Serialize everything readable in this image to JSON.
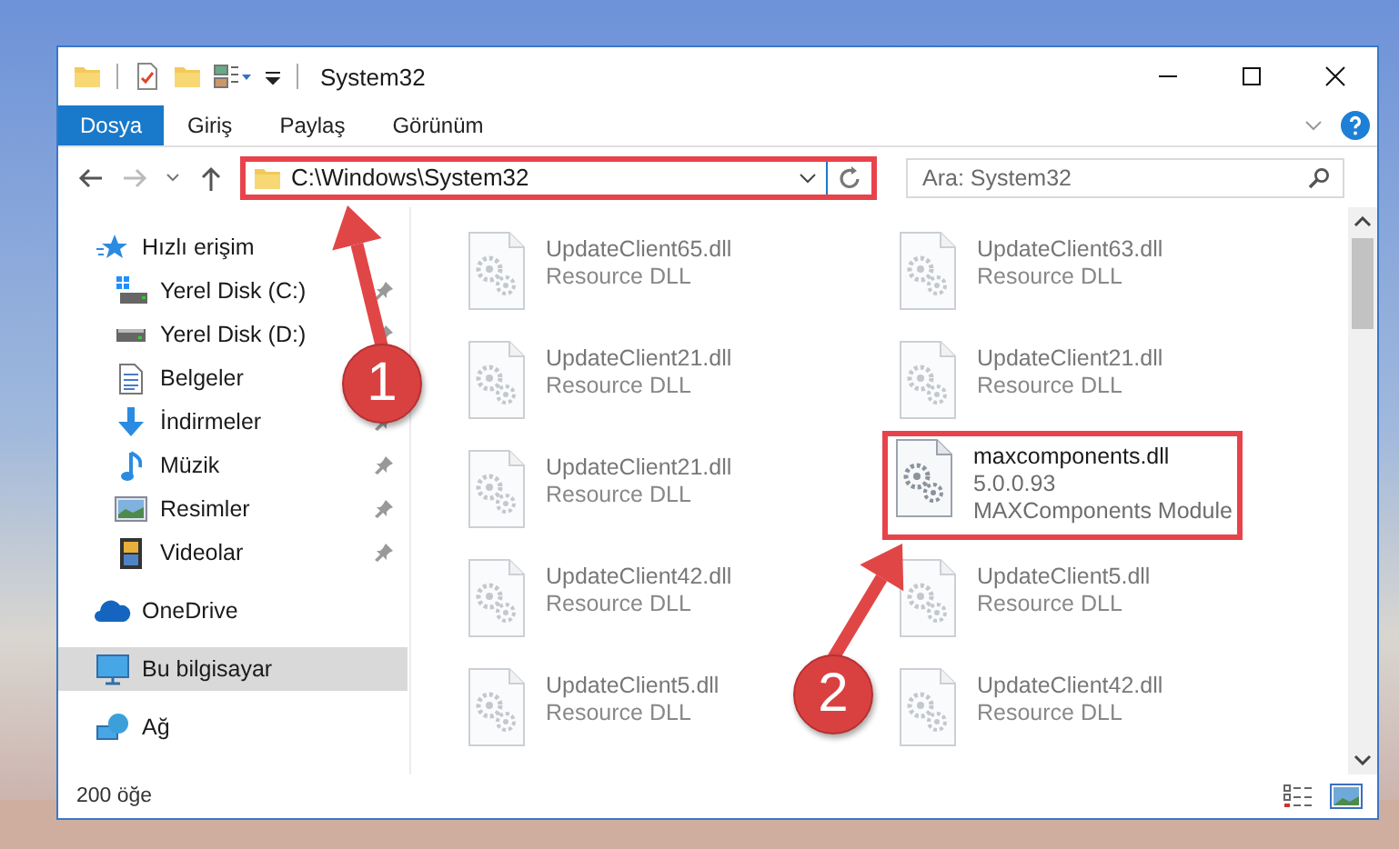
{
  "window": {
    "title": "System32"
  },
  "ribbon_tabs": [
    {
      "label": "Dosya",
      "selected": true
    },
    {
      "label": "Giriş",
      "selected": false
    },
    {
      "label": "Paylaş",
      "selected": false
    },
    {
      "label": "Görünüm",
      "selected": false
    }
  ],
  "address_bar": {
    "path": "C:\\Windows\\System32",
    "highlighted": true
  },
  "search": {
    "placeholder": "Ara: System32"
  },
  "navigation": [
    {
      "label": "Hızlı erişim",
      "kind": "star",
      "selected": false,
      "children": [
        {
          "label": "Yerel Disk (C:)",
          "kind": "system-drive",
          "pinned": true
        },
        {
          "label": "Yerel Disk (D:)",
          "kind": "drive",
          "pinned": true
        },
        {
          "label": "Belgeler",
          "kind": "document"
        },
        {
          "label": "İndirmeler",
          "kind": "download",
          "pinned": true
        },
        {
          "label": "Müzik",
          "kind": "music",
          "pinned": true
        },
        {
          "label": "Resimler",
          "kind": "pictures",
          "pinned": true
        },
        {
          "label": "Videolar",
          "kind": "videos",
          "pinned": true
        }
      ]
    },
    {
      "label": "OneDrive",
      "kind": "cloud",
      "selected": false
    },
    {
      "label": "Bu bilgisayar",
      "kind": "computer",
      "selected": true
    },
    {
      "label": "Ağ",
      "kind": "network",
      "selected": false
    }
  ],
  "files": [
    {
      "name": "UpdateClient65.dll",
      "description": "Resource DLL",
      "dimmed": true,
      "highlighted": false
    },
    {
      "name": "UpdateClient63.dll",
      "description": "Resource DLL",
      "dimmed": true,
      "highlighted": false
    },
    {
      "name": "UpdateClient21.dll",
      "description": "Resource DLL",
      "dimmed": true,
      "highlighted": false
    },
    {
      "name": "UpdateClient21.dll",
      "description": "Resource DLL",
      "dimmed": true,
      "highlighted": false
    },
    {
      "name": "UpdateClient21.dll",
      "description": "Resource DLL",
      "dimmed": true,
      "highlighted": false
    },
    {
      "name": "maxcomponents.dll",
      "version": "5.0.0.93",
      "description": "MAXComponents Module",
      "dimmed": false,
      "highlighted": true
    },
    {
      "name": "UpdateClient42.dll",
      "description": "Resource DLL",
      "dimmed": true,
      "highlighted": false
    },
    {
      "name": "UpdateClient5.dll",
      "description": "Resource DLL",
      "dimmed": true,
      "highlighted": false
    },
    {
      "name": "UpdateClient5.dll",
      "description": "Resource DLL",
      "dimmed": true,
      "highlighted": false
    },
    {
      "name": "UpdateClient42.dll",
      "description": "Resource DLL",
      "dimmed": true,
      "highlighted": false
    }
  ],
  "status_bar": {
    "item_count": "200 öğe"
  },
  "annotations": [
    {
      "label": "1"
    },
    {
      "label": "2"
    }
  ]
}
